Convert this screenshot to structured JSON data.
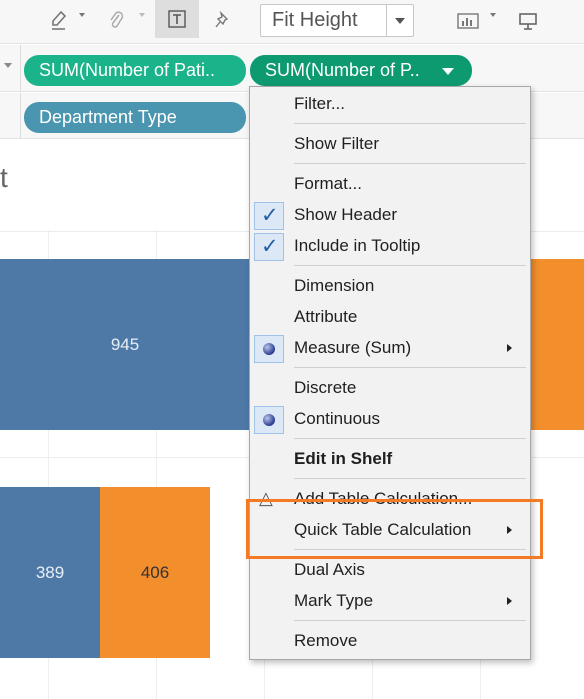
{
  "toolbar": {
    "fit_label": "Fit Height",
    "icons": [
      "highlighter-icon",
      "paperclip-icon",
      "text-label-icon",
      "pin-icon",
      "show-me-icon",
      "presentation-icon"
    ]
  },
  "columns_shelf": {
    "pills": [
      {
        "label": "SUM(Number of Pati..",
        "color": "#1ab38a"
      },
      {
        "label": "SUM(Number of P..",
        "color": "#0e9a70"
      }
    ]
  },
  "rows_shelf": {
    "pills": [
      {
        "label": "Department Type",
        "color": "#4a96b0"
      }
    ]
  },
  "view": {
    "title_fragment": "t",
    "bar_labels": {
      "row1_blue": "945",
      "row2_blue": "389",
      "row2_orange": "406"
    },
    "colors": {
      "blue": "#4e79a7",
      "orange": "#f28e2b"
    }
  },
  "context_menu": {
    "items": {
      "filter": "Filter...",
      "show_filter": "Show Filter",
      "format": "Format...",
      "show_header": "Show Header",
      "include_in_tooltip": "Include in Tooltip",
      "dimension": "Dimension",
      "attribute": "Attribute",
      "measure_sum": "Measure (Sum)",
      "discrete": "Discrete",
      "continuous": "Continuous",
      "edit_in_shelf": "Edit in Shelf",
      "add_table_calculation": "Add Table Calculation...",
      "quick_table_calculation": "Quick Table Calculation",
      "dual_axis": "Dual Axis",
      "mark_type": "Mark Type",
      "remove": "Remove"
    },
    "checked": [
      "Show Header",
      "Include in Tooltip"
    ],
    "selected_radio": [
      "Measure (Sum)",
      "Continuous"
    ],
    "highlight_color": "#f47a25"
  }
}
